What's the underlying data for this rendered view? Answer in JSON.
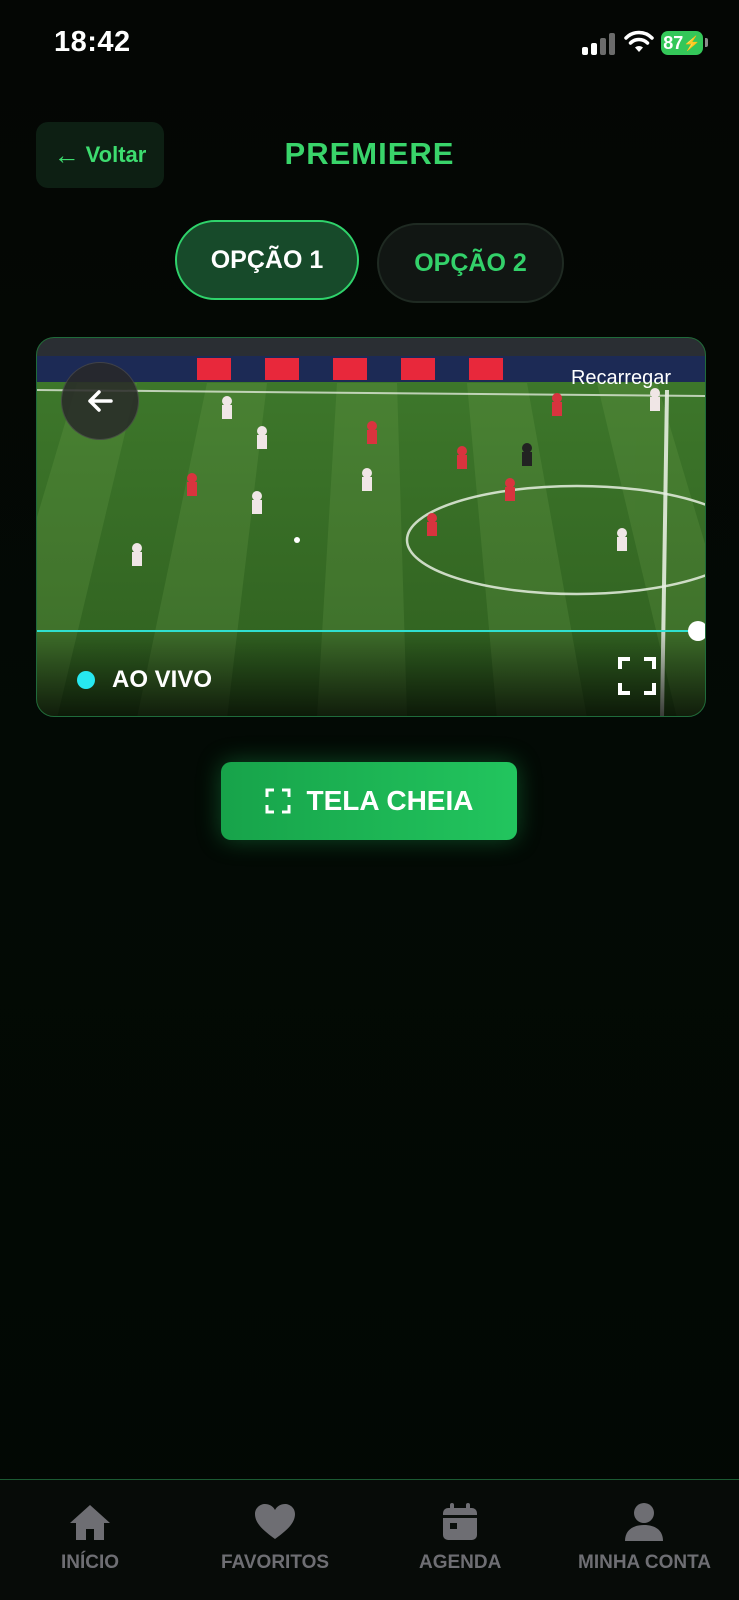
{
  "status_bar": {
    "time": "18:42",
    "battery": "87",
    "icons": [
      "cellular-signal-icon",
      "wifi-icon",
      "battery-charging-icon"
    ]
  },
  "header": {
    "back_label": "Voltar",
    "title": "PREMIERE"
  },
  "tabs": [
    {
      "label": "OPÇÃO 1",
      "selected": true
    },
    {
      "label": "OPÇÃO 2",
      "selected": false
    }
  ],
  "player": {
    "reload_label": "Recarregar",
    "live_label": "AO VIVO",
    "progress": 1.0
  },
  "fullscreen_button": {
    "label": "TELA CHEIA"
  },
  "bottom_nav": [
    {
      "label": "INÍCIO",
      "icon": "home-icon"
    },
    {
      "label": "FAVORITOS",
      "icon": "heart-icon"
    },
    {
      "label": "AGENDA",
      "icon": "calendar-icon"
    },
    {
      "label": "MINHA CONTA",
      "icon": "user-icon"
    }
  ],
  "colors": {
    "accent": "#22c55e",
    "title": "#39d46a",
    "live_dot": "#27e8f0",
    "nav_inactive": "#6e6e73",
    "background": "#030803"
  }
}
